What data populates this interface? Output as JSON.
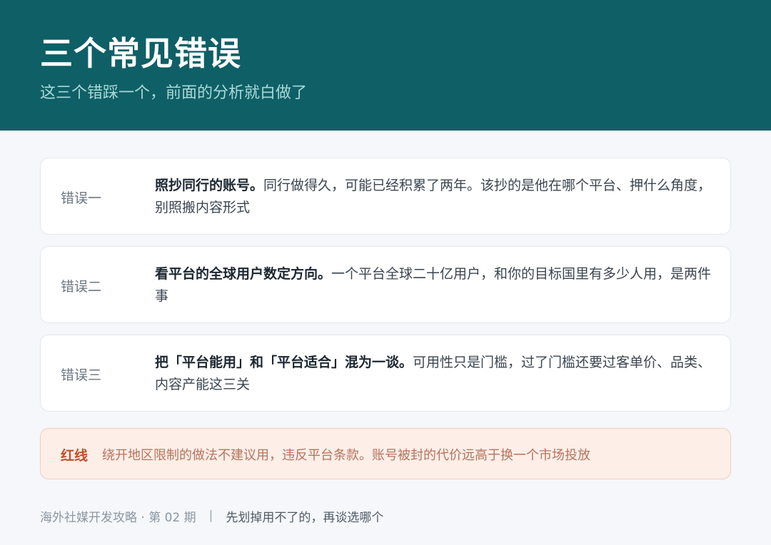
{
  "header": {
    "title": "三个常见错误",
    "subtitle": "这三个错踩一个，前面的分析就白做了"
  },
  "mistakes": [
    {
      "label": "错误一",
      "headline": "照抄同行的账号。",
      "body": "同行做得久，可能已经积累了两年。该抄的是他在哪个平台、押什么角度，别照搬内容形式"
    },
    {
      "label": "错误二",
      "headline": "看平台的全球用户数定方向。",
      "body": "一个平台全球二十亿用户，和你的目标国里有多少人用，是两件事"
    },
    {
      "label": "错误三",
      "headline": "把「平台能用」和「平台适合」混为一谈。",
      "body": "可用性只是门槛，过了门槛还要过客单价、品类、内容产能这三关"
    }
  ],
  "redline": {
    "label": "红线",
    "text": "绕开地区限制的做法不建议用，违反平台条款。账号被封的代价远高于换一个市场投放"
  },
  "footer": {
    "series": "海外社媒开发攻略 · 第 02 期",
    "separator": "|",
    "next": "先划掉用不了的，再谈选哪个"
  },
  "colors": {
    "header_bg": "#0f5f66",
    "redline_accent": "#c0502a"
  }
}
